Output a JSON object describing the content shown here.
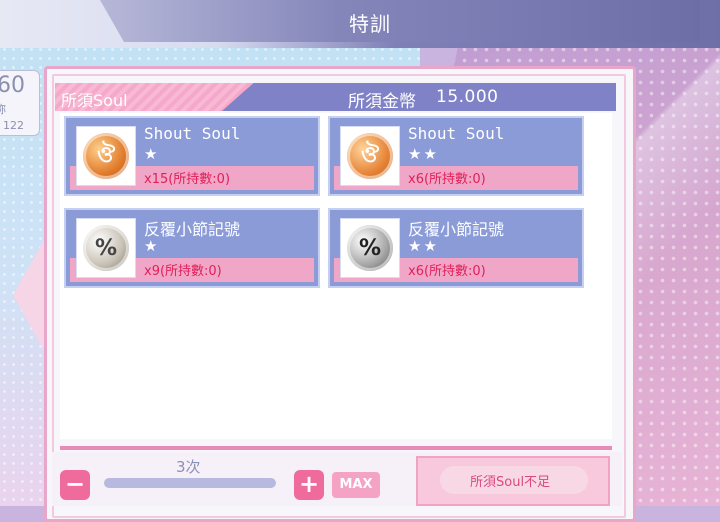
{
  "window": {
    "title": "特訓"
  },
  "side_card": {
    "value": "60",
    "fragment": "称",
    "sub_value": "122"
  },
  "requirements": {
    "soul_label": "所須Soul",
    "coin_label": "所須金幣",
    "coin_value": "15.000"
  },
  "items": [
    {
      "name": "Shout Soul",
      "stars": "★",
      "quantity": "x15(所持數:0)",
      "icon": "shout-soul-bronze-medal-icon"
    },
    {
      "name": "Shout Soul",
      "stars": "★★",
      "quantity": "x6(所持數:0)",
      "icon": "shout-soul-bronze-medal-icon"
    },
    {
      "name": "反覆小節記號",
      "stars": "★",
      "quantity": "x9(所持數:0)",
      "icon": "repeat-sign-medal-icon"
    },
    {
      "name": "反覆小節記號",
      "stars": "★★",
      "quantity": "x6(所持數:0)",
      "icon": "repeat-sign-medal-icon"
    }
  ],
  "controls": {
    "count": "3次",
    "minus": "−",
    "plus": "+",
    "max": "MAX",
    "action": "所須Soul不足"
  }
}
